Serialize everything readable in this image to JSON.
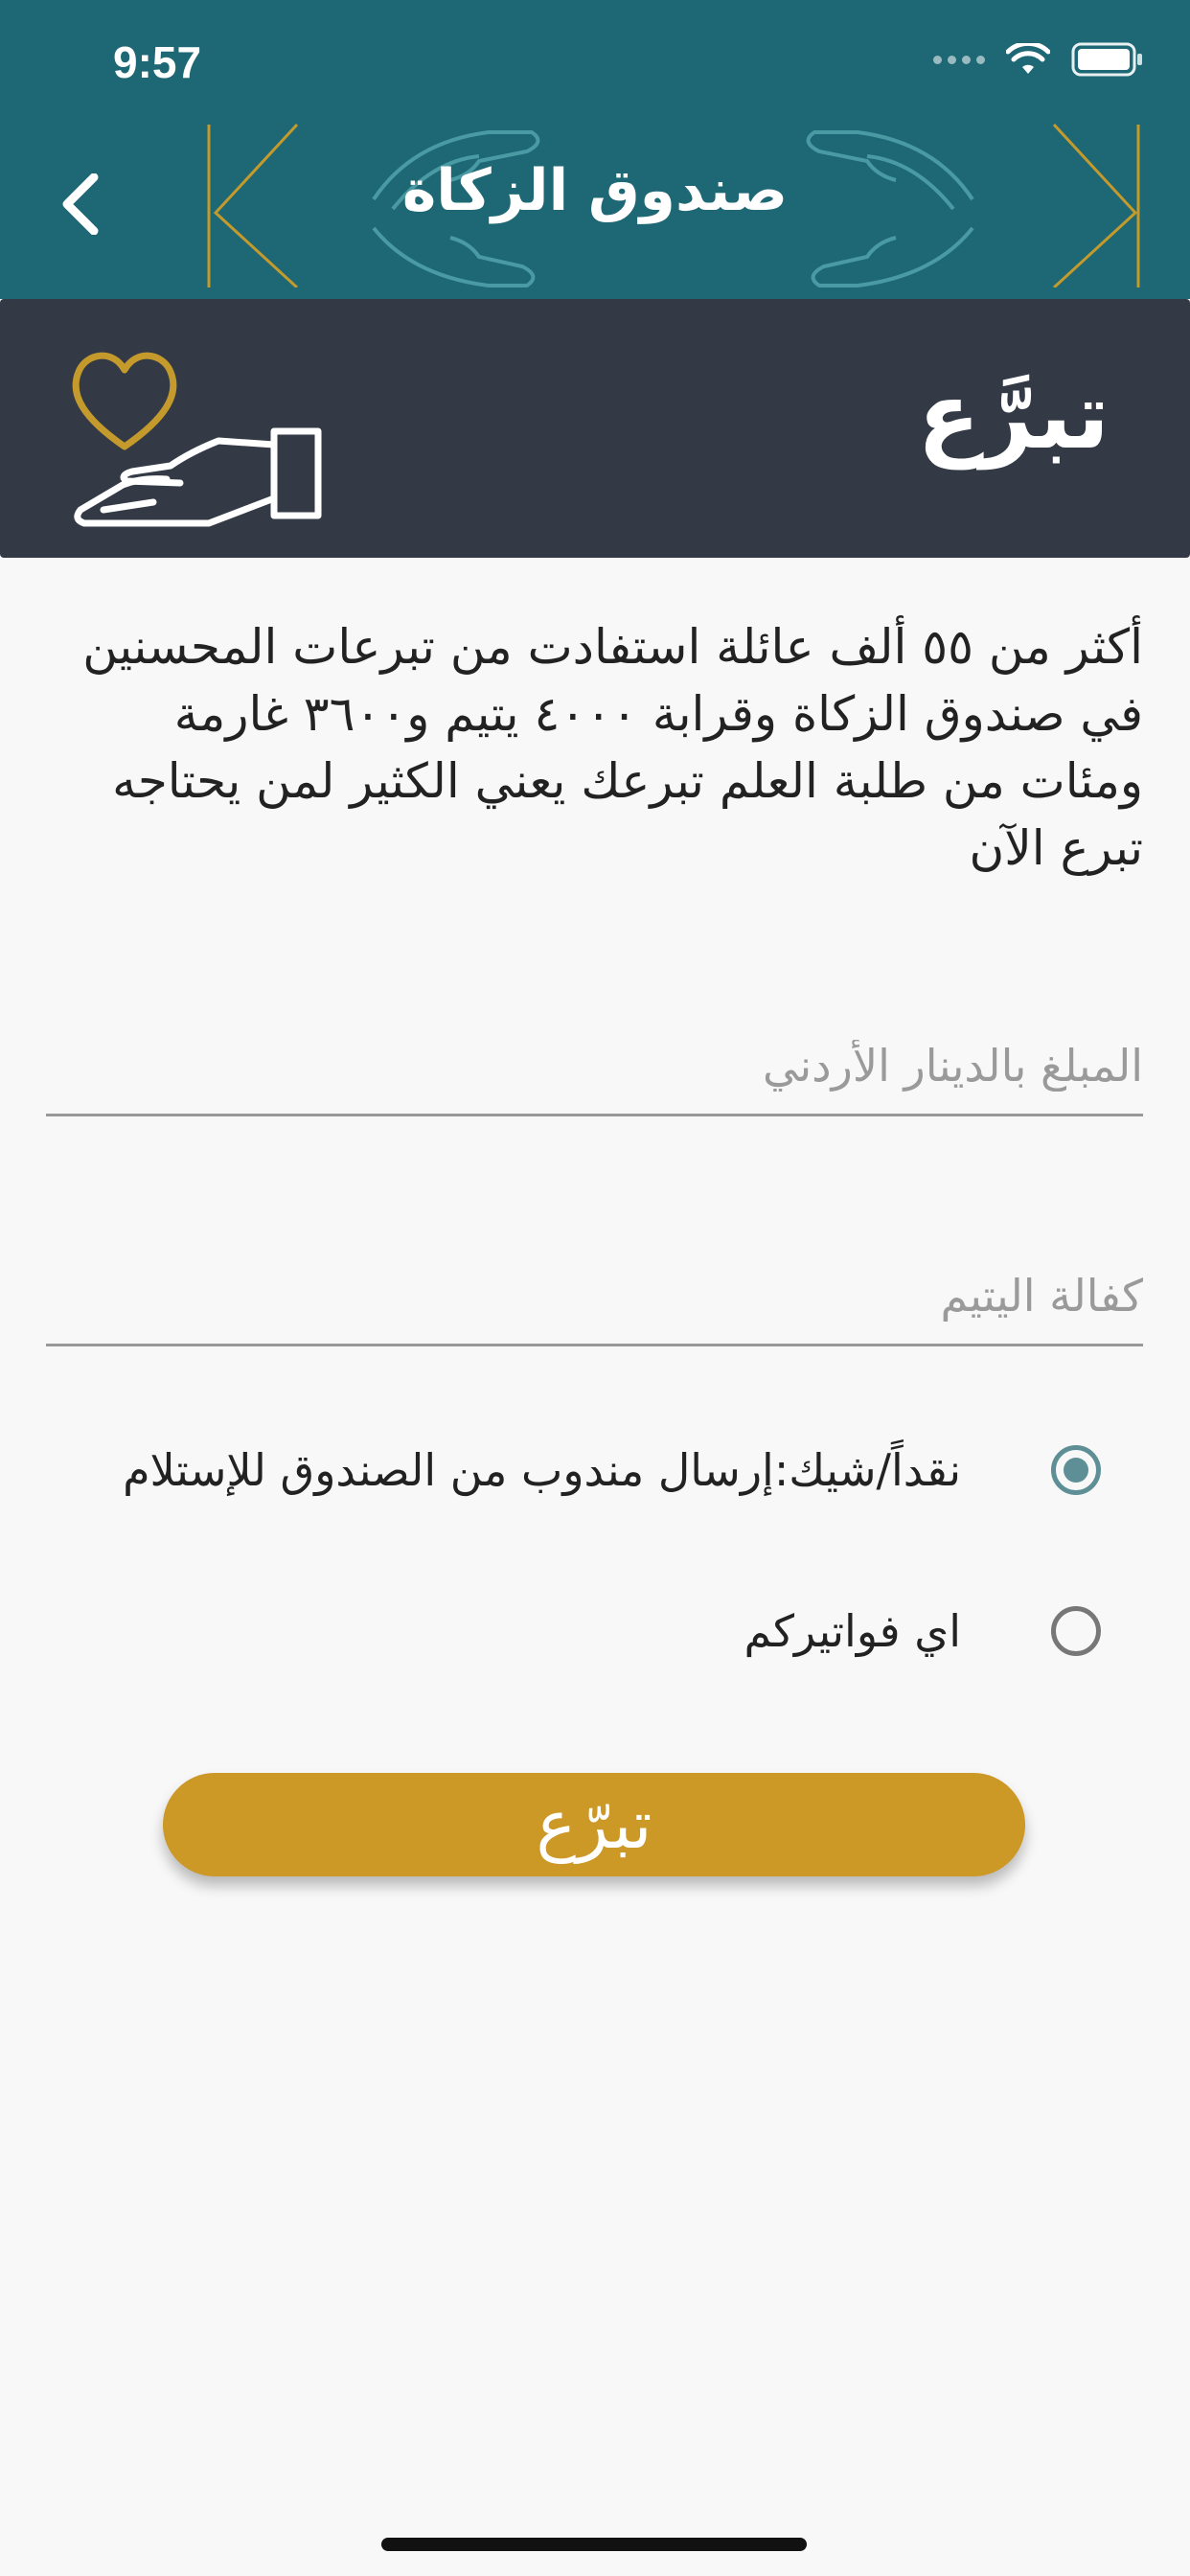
{
  "status_bar": {
    "time": "9:57"
  },
  "nav": {
    "title": "صندوق الزكاة"
  },
  "banner": {
    "title": "تبرَّع"
  },
  "description": "أكثر من ٥٥ ألف عائلة استفادت من تبرعات المحسنين في صندوق الزكاة وقرابة ٤٠٠٠ يتيم و٣٦٠٠ غارمة ومئات من طلبة العلم تبرعك يعني الكثير لمن يحتاجه تبرع الآن",
  "form": {
    "amount_placeholder": "المبلغ بالدينار الأردني",
    "category_placeholder": "كفالة اليتيم",
    "options": [
      {
        "label": "نقداً/شيك:إرسال مندوب من الصندوق للإستلام",
        "selected": true
      },
      {
        "label": "اي فواتيركم",
        "selected": false
      }
    ],
    "submit_label": "تبرّع"
  },
  "colors": {
    "header": "#1d6874",
    "banner": "#333a46",
    "accent_gold": "#cc9826",
    "radio_selected": "#5e8f96"
  },
  "icons": [
    "back-chevron-icon",
    "wifi-icon",
    "battery-icon",
    "heart-hand-icon",
    "hands-pattern-icon"
  ]
}
